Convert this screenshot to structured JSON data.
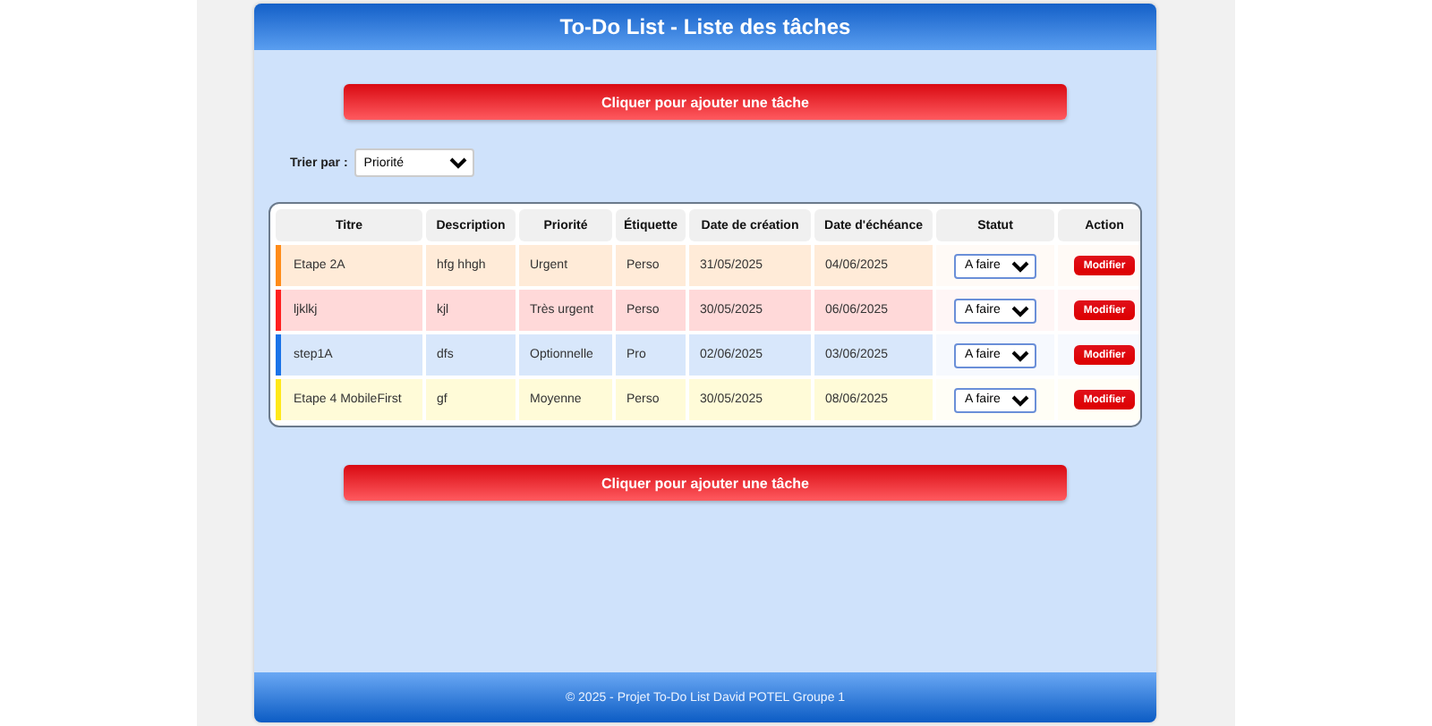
{
  "header": {
    "title": "To-Do List - Liste des tâches"
  },
  "add_button_top": "Cliquer pour ajouter une tâche",
  "sort": {
    "label": "Trier par :",
    "value": "Priorité"
  },
  "table": {
    "columns": [
      "Titre",
      "Description",
      "Priorité",
      "Étiquette",
      "Date de création",
      "Date d'échéance",
      "Statut",
      "Action"
    ],
    "rows": [
      {
        "title": "Etape 2A",
        "description": "hfg hhgh",
        "priority": "Urgent",
        "tag": "Perso",
        "created": "31/05/2025",
        "due": "04/06/2025",
        "status": "A faire",
        "action": "Modifier",
        "color": "#ff8c1a"
      },
      {
        "title": "ljklkj",
        "description": "kjl",
        "priority": "Très urgent",
        "tag": "Perso",
        "created": "30/05/2025",
        "due": "06/06/2025",
        "status": "A faire",
        "action": "Modifier",
        "color": "#ff2020"
      },
      {
        "title": "step1A",
        "description": "dfs",
        "priority": "Optionnelle",
        "tag": "Pro",
        "created": "02/06/2025",
        "due": "03/06/2025",
        "status": "A faire",
        "action": "Modifier",
        "color": "#1a73e8"
      },
      {
        "title": "Etape 4 MobileFirst",
        "description": "gf",
        "priority": "Moyenne",
        "tag": "Perso",
        "created": "30/05/2025",
        "due": "08/06/2025",
        "status": "A faire",
        "action": "Modifier",
        "color": "#ffe81a"
      }
    ]
  },
  "add_button_bottom": "Cliquer pour ajouter une tâche",
  "footer": "© 2025 - Projet To-Do List David POTEL Groupe 1"
}
